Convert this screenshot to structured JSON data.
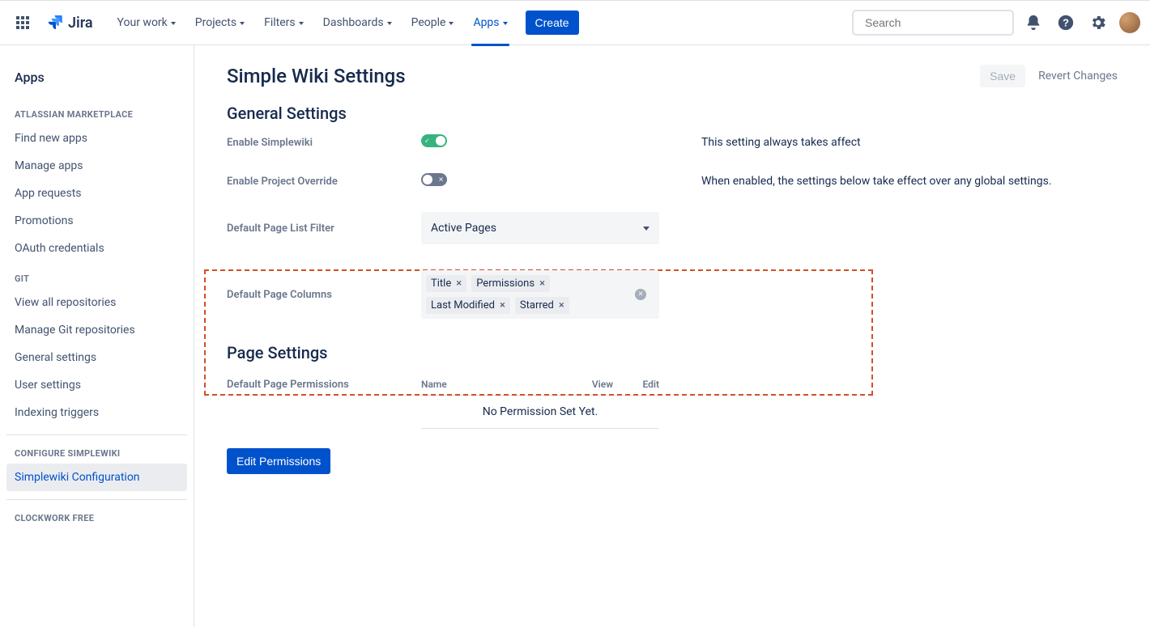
{
  "header": {
    "logo_text": "Jira",
    "nav": [
      "Your work",
      "Projects",
      "Filters",
      "Dashboards",
      "People",
      "Apps"
    ],
    "active_nav_index": 5,
    "create_label": "Create",
    "search_placeholder": "Search"
  },
  "sidebar": {
    "title": "Apps",
    "groups": [
      {
        "heading": "ATLASSIAN MARKETPLACE",
        "items": [
          "Find new apps",
          "Manage apps",
          "App requests",
          "Promotions",
          "OAuth credentials"
        ]
      },
      {
        "heading": "GIT",
        "items": [
          "View all repositories",
          "Manage Git repositories",
          "General settings",
          "User settings",
          "Indexing triggers"
        ]
      },
      {
        "heading": "CONFIGURE SIMPLEWIKI",
        "items": [
          "Simplewiki Configuration"
        ],
        "active_index": 0
      },
      {
        "heading": "CLOCKWORK FREE",
        "items": []
      }
    ]
  },
  "page": {
    "title": "Simple Wiki Settings",
    "save_label": "Save",
    "revert_label": "Revert Changes",
    "general_heading": "General Settings",
    "rows": {
      "enable_simplewiki": {
        "label": "Enable Simplewiki",
        "on": true,
        "help": "This setting always takes affect"
      },
      "enable_override": {
        "label": "Enable Project Override",
        "on": false,
        "help": "When enabled, the settings below take effect over any global settings."
      },
      "default_filter": {
        "label": "Default Page List Filter",
        "value": "Active Pages"
      },
      "default_columns": {
        "label": "Default Page Columns",
        "tags": [
          "Title",
          "Permissions",
          "Last Modified",
          "Starred"
        ]
      }
    },
    "page_settings_heading": "Page Settings",
    "perm": {
      "label": "Default Page Permissions",
      "cols": {
        "name": "Name",
        "view": "View",
        "edit": "Edit"
      },
      "empty": "No Permission Set Yet."
    },
    "edit_permissions_label": "Edit Permissions"
  }
}
